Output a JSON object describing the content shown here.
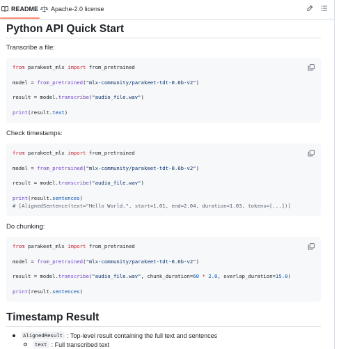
{
  "tabs": {
    "readme": "README",
    "license": "Apache-2.0 license"
  },
  "sections": {
    "quick_start_title": "Python API Quick Start",
    "transcribe_label": "Transcribe a file:",
    "timestamps_label": "Check timestamps:",
    "chunking_label": "Do chunking:",
    "timestamp_result_title": "Timestamp Result"
  },
  "code": {
    "block1": [
      [
        [
          "kw",
          "from"
        ],
        [
          "t",
          " parakeet_mlx "
        ],
        [
          "kw",
          "import"
        ],
        [
          "t",
          " from_pretrained"
        ]
      ],
      [],
      [
        [
          "t",
          "model = "
        ],
        [
          "fn",
          "from_pretrained"
        ],
        [
          "t",
          "("
        ],
        [
          "st",
          "\"mlx-community/parakeet-tdt-0.6b-v2\""
        ],
        [
          "t",
          ")"
        ]
      ],
      [],
      [
        [
          "t",
          "result = model."
        ],
        [
          "fn",
          "transcribe"
        ],
        [
          "t",
          "("
        ],
        [
          "st",
          "\"audio_file.wav\""
        ],
        [
          "t",
          ")"
        ]
      ],
      [],
      [
        [
          "fn",
          "print"
        ],
        [
          "t",
          "(result."
        ],
        [
          "nm",
          "text"
        ],
        [
          "t",
          ")"
        ]
      ]
    ],
    "block2": [
      [
        [
          "kw",
          "from"
        ],
        [
          "t",
          " parakeet_mlx "
        ],
        [
          "kw",
          "import"
        ],
        [
          "t",
          " from_pretrained"
        ]
      ],
      [],
      [
        [
          "t",
          "model = "
        ],
        [
          "fn",
          "from_pretrained"
        ],
        [
          "t",
          "("
        ],
        [
          "st",
          "\"mlx-community/parakeet-tdt-0.6b-v2\""
        ],
        [
          "t",
          ")"
        ]
      ],
      [],
      [
        [
          "t",
          "result = model."
        ],
        [
          "fn",
          "transcribe"
        ],
        [
          "t",
          "("
        ],
        [
          "st",
          "\"audio_file.wav\""
        ],
        [
          "t",
          ")"
        ]
      ],
      [],
      [
        [
          "fn",
          "print"
        ],
        [
          "t",
          "(result."
        ],
        [
          "nm",
          "sentences"
        ],
        [
          "t",
          ")"
        ]
      ],
      [
        [
          "cm",
          "# [AlignedSentence(text=\"Hello World.\", start=1.01, end=2.04, duration=1.03, tokens=[...])]"
        ]
      ]
    ],
    "block3": [
      [
        [
          "kw",
          "from"
        ],
        [
          "t",
          " parakeet_mlx "
        ],
        [
          "kw",
          "import"
        ],
        [
          "t",
          " from_pretrained"
        ]
      ],
      [],
      [
        [
          "t",
          "model = "
        ],
        [
          "fn",
          "from_pretrained"
        ],
        [
          "t",
          "("
        ],
        [
          "st",
          "\"mlx-community/parakeet-tdt-0.6b-v2\""
        ],
        [
          "t",
          ")"
        ]
      ],
      [],
      [
        [
          "t",
          "result = model."
        ],
        [
          "fn",
          "transcribe"
        ],
        [
          "t",
          "("
        ],
        [
          "st",
          "\"audio_file.wav\""
        ],
        [
          "t",
          ", chunk_duration="
        ],
        [
          "nm",
          "60"
        ],
        [
          "t",
          " "
        ],
        [
          "kw",
          "*"
        ],
        [
          "t",
          " "
        ],
        [
          "nm",
          "2.0"
        ],
        [
          "t",
          ", overlap_duration="
        ],
        [
          "nm",
          "15.0"
        ],
        [
          "t",
          ")"
        ]
      ],
      [],
      [
        [
          "fn",
          "print"
        ],
        [
          "t",
          "(result."
        ],
        [
          "nm",
          "sentences"
        ],
        [
          "t",
          ")"
        ]
      ]
    ]
  },
  "result_list": [
    {
      "code": "AlignedResult",
      "text": ": Top-level result containing the full text and sentences"
    },
    {
      "code": "text",
      "text": ": Full transcribed text"
    }
  ]
}
